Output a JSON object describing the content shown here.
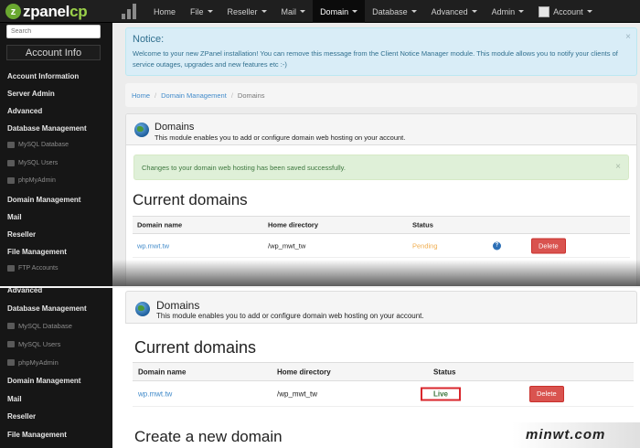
{
  "app": {
    "logo_main": "zpanel",
    "logo_cp": "cp"
  },
  "nav": {
    "items": [
      {
        "label": "Home",
        "caret": false,
        "active": false
      },
      {
        "label": "File",
        "caret": true,
        "active": false
      },
      {
        "label": "Reseller",
        "caret": true,
        "active": false
      },
      {
        "label": "Mail",
        "caret": true,
        "active": false
      },
      {
        "label": "Domain",
        "caret": true,
        "active": true
      },
      {
        "label": "Database",
        "caret": true,
        "active": false
      },
      {
        "label": "Advanced",
        "caret": true,
        "active": false
      },
      {
        "label": "Admin",
        "caret": true,
        "active": false
      },
      {
        "label": "Account",
        "caret": true,
        "active": false
      }
    ]
  },
  "sidebar": {
    "search_placeholder": "Search",
    "account_info_button": "Account Info",
    "items": [
      {
        "label": "Account Information",
        "type": "section"
      },
      {
        "label": "Server Admin",
        "type": "section"
      },
      {
        "label": "Advanced",
        "type": "section"
      },
      {
        "label": "Database Management",
        "type": "section"
      },
      {
        "label": "MySQL Database",
        "type": "sub"
      },
      {
        "label": "MySQL Users",
        "type": "sub"
      },
      {
        "label": "phpMyAdmin",
        "type": "sub"
      },
      {
        "label": "Domain Management",
        "type": "section"
      },
      {
        "label": "Mail",
        "type": "section"
      },
      {
        "label": "Reseller",
        "type": "section"
      },
      {
        "label": "File Management",
        "type": "section"
      },
      {
        "label": "FTP Accounts",
        "type": "sub"
      }
    ]
  },
  "notice": {
    "title": "Notice:",
    "body": "Welcome to your new ZPanel installation! You can remove this message from the Client Notice Manager module. This module allows you to notify your clients of service outages, upgrades and new features etc :-)",
    "close": "×"
  },
  "breadcrumb": {
    "home": "Home",
    "section": "Domain Management",
    "current": "Domains",
    "separator": "/"
  },
  "panel": {
    "title": "Domains",
    "description": "This module enables you to add or configure domain web hosting on your account."
  },
  "success_message": {
    "text": "Changes to your domain web hosting has been saved successfully.",
    "close": "×"
  },
  "current_domains": {
    "heading": "Current domains",
    "columns": [
      "Domain name",
      "Home directory",
      "Status"
    ],
    "row_before": {
      "domain": "wp.mwt.tw",
      "home_directory": "/wp_mwt_tw",
      "status": "Pending",
      "help": "?",
      "delete_label": "Delete"
    },
    "row_after": {
      "domain": "wp.mwt.tw",
      "home_directory": "/wp_mwt_tw",
      "status": "Live",
      "delete_label": "Delete"
    }
  },
  "sidebar2": {
    "items": [
      {
        "label": "Advanced",
        "type": "section"
      },
      {
        "label": "Database Management",
        "type": "section"
      },
      {
        "label": "MySQL Database",
        "type": "sub"
      },
      {
        "label": "MySQL Users",
        "type": "sub"
      },
      {
        "label": "phpMyAdmin",
        "type": "sub"
      },
      {
        "label": "Domain Management",
        "type": "section"
      },
      {
        "label": "Mail",
        "type": "section"
      },
      {
        "label": "Reseller",
        "type": "section"
      },
      {
        "label": "File Management",
        "type": "section"
      }
    ]
  },
  "create": {
    "heading": "Create a new domain"
  },
  "watermark": "minwt.com",
  "colors": {
    "navbar": "#1f1f1f",
    "sidebar": "#161616",
    "link": "#428bca",
    "pending": "#f0ad4e",
    "live": "#3c763d",
    "delete": "#d9534f",
    "highlight": "#d9262c"
  }
}
